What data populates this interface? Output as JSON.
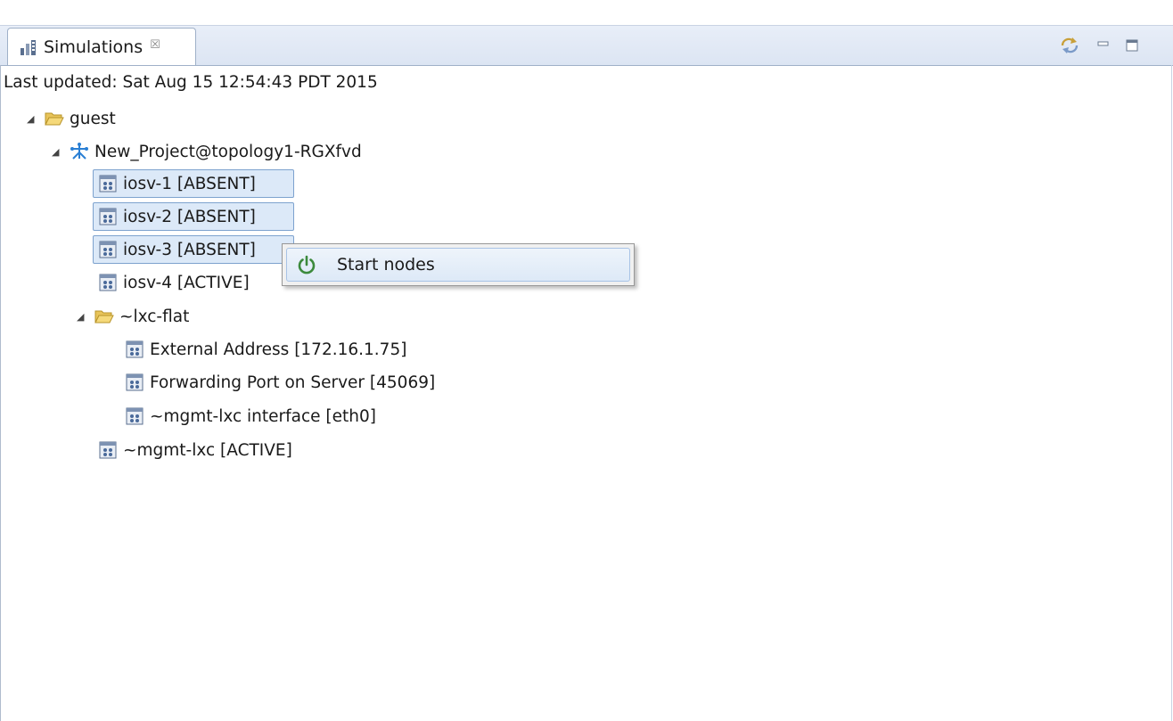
{
  "view": {
    "tab_label": "Simulations",
    "tab_close": "☒",
    "toolbar": {
      "sync_icon": "sync-icon",
      "minimize_icon": "minimize-icon",
      "maximize_icon": "maximize-icon"
    }
  },
  "status": {
    "last_updated": "Last updated: Sat Aug 15 12:54:43 PDT 2015"
  },
  "tree": {
    "guest": "guest",
    "project": "New_Project@topology1-RGXfvd",
    "iosv1": "iosv-1  [ABSENT]",
    "iosv2": "iosv-2  [ABSENT]",
    "iosv3": "iosv-3  [ABSENT]",
    "iosv4": "iosv-4  [ACTIVE]",
    "lxc_flat": "~lxc-flat",
    "ext_addr": "External Address  [172.16.1.75]",
    "fwd_port": "Forwarding Port on Server  [45069]",
    "mgmt_iface": "~mgmt-lxc interface  [eth0]",
    "mgmt_lxc": "~mgmt-lxc  [ACTIVE]"
  },
  "context_menu": {
    "items": [
      {
        "label": "Start nodes",
        "icon": "power-icon"
      }
    ]
  },
  "colors": {
    "accent": "#3c8a3c",
    "selection": "#dce9f8",
    "tabbar": "#dce5f3"
  }
}
